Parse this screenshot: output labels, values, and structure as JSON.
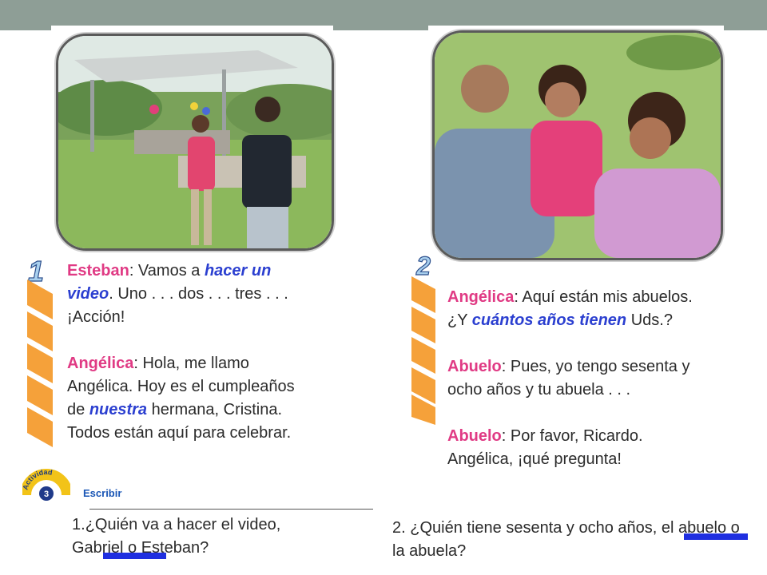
{
  "panel1": {
    "step": "1",
    "lines": [
      {
        "speaker": "Esteban",
        "t1": ": Vamos a ",
        "kw": "hacer un video",
        "t2": ". Uno . . . dos . . . tres . . . ¡Acción!"
      },
      {
        "speaker": "Angélica",
        "t1": ": Hola, me llamo Angélica. Hoy es el cumpleaños de ",
        "kw": "nuestra",
        "t2": " hermana, Cristina. Todos están aquí para celebrar."
      }
    ]
  },
  "panel2": {
    "step": "2",
    "lines": [
      {
        "speaker": "Angélica",
        "t1": ": Aquí están mis abuelos. ¿Y ",
        "kw": "cuántos años tienen",
        "t2": " Uds.?"
      },
      {
        "speaker": "Abuelo",
        "t1": ": Pues, yo tengo sesenta y ocho años y tu abuela . . ."
      },
      {
        "speaker": "Abuelo",
        "t1": ": Por favor, Ricardo. Angélica, ¡qué pregunta!"
      }
    ]
  },
  "activity": {
    "badge_word": "Actividad",
    "badge_number": "3",
    "label": "Escribir"
  },
  "questions": [
    {
      "num": "1.",
      "text": "¿Quién va a hacer el video, Gabriel o Esteban?"
    },
    {
      "num": "2.",
      "text": "¿Quién tiene sesenta y ocho años, el abuelo o la abuela?"
    }
  ],
  "colors": {
    "topbar": "#8e9e96",
    "speaker": "#e03a84",
    "keyword": "#2b3fd0",
    "answer_blank": "#1f2fe0",
    "chevron": "#f5a13a"
  }
}
